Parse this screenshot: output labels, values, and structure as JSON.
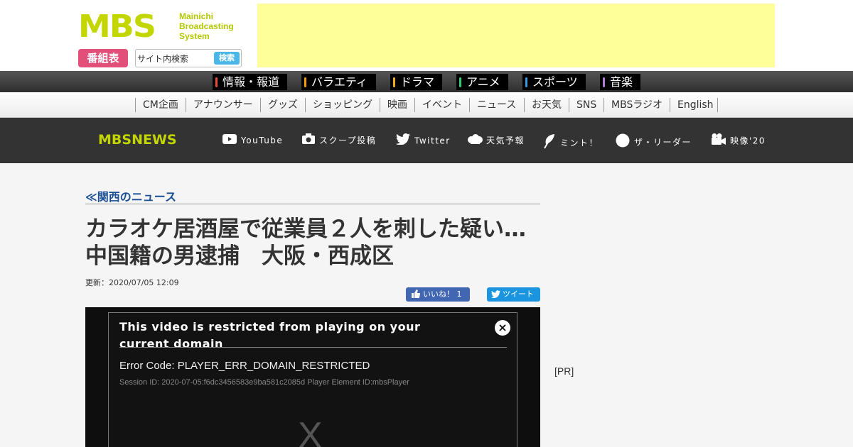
{
  "header": {
    "logo_mark": "MBS",
    "logo_sub": [
      "Mainichi",
      "Broadcasting",
      "System"
    ],
    "program_label": "番組表",
    "search": {
      "value": "サイト内検索",
      "button": "検索"
    },
    "ad_color": "#ffff99"
  },
  "genres": [
    {
      "label": "情報・報道",
      "color": "#e84a3c"
    },
    {
      "label": "バラエティ",
      "color": "#f39c12"
    },
    {
      "label": "ドラマ",
      "color": "#f5a623"
    },
    {
      "label": "アニメ",
      "color": "#2ecc71"
    },
    {
      "label": "スポーツ",
      "color": "#3498db"
    },
    {
      "label": "音楽",
      "color": "#b07ad9"
    }
  ],
  "subnav": [
    "CM企画",
    "アナウンサー",
    "グッズ",
    "ショッピング",
    "映画",
    "イベント",
    "ニュース",
    "お天気",
    "SNS",
    "MBSラジオ",
    "English"
  ],
  "newsbar": {
    "logo": "MBSNEWS",
    "items": [
      {
        "label": "YouTube",
        "icon": "youtube-icon"
      },
      {
        "label": "スクープ投稿",
        "icon": "camera-icon"
      },
      {
        "label": "Twitter",
        "icon": "twitter-icon"
      },
      {
        "label": "天気予報",
        "icon": "cloud-icon"
      },
      {
        "label": "ミント！",
        "icon": "leaf-icon"
      },
      {
        "label": "ザ・リーダー",
        "icon": "circle-icon"
      },
      {
        "label": "映像'20",
        "icon": "video-camera-icon"
      }
    ]
  },
  "article": {
    "back_link": "≪関西のニュース",
    "title": "カラオケ居酒屋で従業員２人を刺した疑い…中国籍の男逮捕　大阪・西成区",
    "updated": "更新：2020/07/05 12:09",
    "like_label": "いいね！ 1",
    "tweet_label": "ツイート"
  },
  "player": {
    "error_title": "This video is restricted from playing on your current domain",
    "close_glyph": "×",
    "error_code": "Error Code: PLAYER_ERR_DOMAIN_RESTRICTED",
    "session": "Session ID: 2020-07-05:f6dc3456583e9ba581c2085d Player Element ID:mbsPlayer",
    "x_glyph": "X"
  },
  "side": {
    "pr_label": "[PR]"
  }
}
